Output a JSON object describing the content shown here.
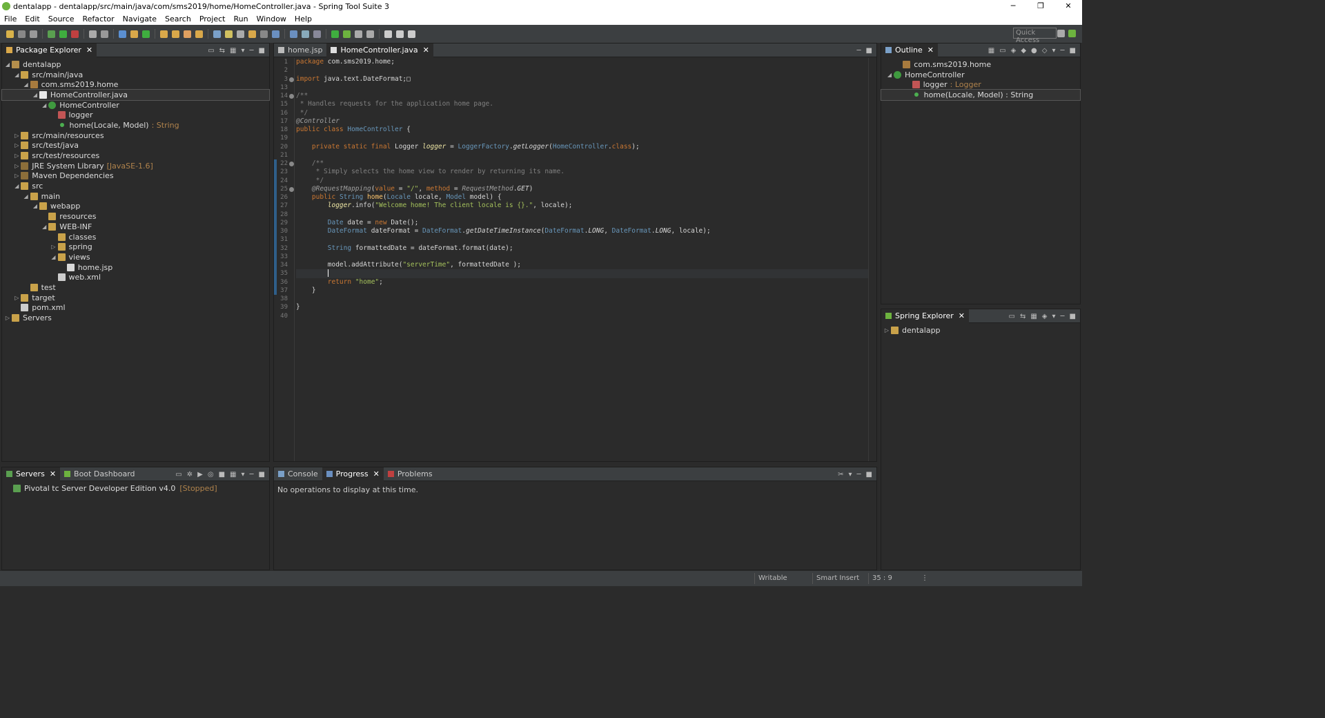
{
  "window": {
    "title": "dentalapp - dentalapp/src/main/java/com/sms2019/home/HomeController.java - Spring Tool Suite 3",
    "minimize": "─",
    "maximize": "❐",
    "close": "✕"
  },
  "menu": [
    "File",
    "Edit",
    "Source",
    "Refactor",
    "Navigate",
    "Search",
    "Project",
    "Run",
    "Window",
    "Help"
  ],
  "toolbar": {
    "quick_access": "Quick Access"
  },
  "package_explorer": {
    "tab": "Package Explorer",
    "tree": [
      {
        "label": "dentalapp",
        "depth": 0,
        "twisty": "◢",
        "icon": "proj"
      },
      {
        "label": "src/main/java",
        "depth": 1,
        "twisty": "◢",
        "icon": "folder"
      },
      {
        "label": "com.sms2019.home",
        "depth": 2,
        "twisty": "◢",
        "icon": "pkg"
      },
      {
        "label": "HomeController.java",
        "depth": 3,
        "twisty": "◢",
        "icon": "java",
        "selected": true
      },
      {
        "label": "HomeController",
        "depth": 4,
        "twisty": "◢",
        "icon": "cls"
      },
      {
        "label": "logger",
        "depth": 5,
        "twisty": "",
        "icon": "field"
      },
      {
        "label": "home(Locale, Model)",
        "suffix": ": String",
        "depth": 5,
        "twisty": "",
        "icon": "method"
      },
      {
        "label": "src/main/resources",
        "depth": 1,
        "twisty": "▷",
        "icon": "folder"
      },
      {
        "label": "src/test/java",
        "depth": 1,
        "twisty": "▷",
        "icon": "folder"
      },
      {
        "label": "src/test/resources",
        "depth": 1,
        "twisty": "▷",
        "icon": "folder"
      },
      {
        "label": "JRE System Library",
        "suffix": "[JavaSE-1.6]",
        "depth": 1,
        "twisty": "▷",
        "icon": "lib"
      },
      {
        "label": "Maven Dependencies",
        "depth": 1,
        "twisty": "▷",
        "icon": "lib"
      },
      {
        "label": "src",
        "depth": 1,
        "twisty": "◢",
        "icon": "folder"
      },
      {
        "label": "main",
        "depth": 2,
        "twisty": "◢",
        "icon": "folder"
      },
      {
        "label": "webapp",
        "depth": 3,
        "twisty": "◢",
        "icon": "folder"
      },
      {
        "label": "resources",
        "depth": 4,
        "twisty": "",
        "icon": "folder"
      },
      {
        "label": "WEB-INF",
        "depth": 4,
        "twisty": "◢",
        "icon": "folder"
      },
      {
        "label": "classes",
        "depth": 5,
        "twisty": "",
        "icon": "folder"
      },
      {
        "label": "spring",
        "depth": 5,
        "twisty": "▷",
        "icon": "folder"
      },
      {
        "label": "views",
        "depth": 5,
        "twisty": "◢",
        "icon": "folder"
      },
      {
        "label": "home.jsp",
        "depth": 6,
        "twisty": "",
        "icon": "jsp"
      },
      {
        "label": "web.xml",
        "depth": 5,
        "twisty": "",
        "icon": "xml"
      },
      {
        "label": "test",
        "depth": 2,
        "twisty": "",
        "icon": "folder"
      },
      {
        "label": "target",
        "depth": 1,
        "twisty": "▷",
        "icon": "folder"
      },
      {
        "label": "pom.xml",
        "depth": 1,
        "twisty": "",
        "icon": "xml"
      },
      {
        "label": "Servers",
        "depth": 0,
        "twisty": "▷",
        "icon": "folder"
      }
    ]
  },
  "editor": {
    "tabs": [
      {
        "label": "home.jsp",
        "active": false
      },
      {
        "label": "HomeController.java",
        "active": true
      }
    ],
    "lines": [
      {
        "n": "1",
        "html": "<span class=\"kw\">package</span> com.sms2019.home;"
      },
      {
        "n": "2",
        "html": ""
      },
      {
        "n": "3",
        "fold": true,
        "html": "<span class=\"kw\">import</span> java.text.DateFormat;&#9633;"
      },
      {
        "n": "13",
        "html": ""
      },
      {
        "n": "14",
        "fold": true,
        "html": "<span class=\"cm\">/**</span>"
      },
      {
        "n": "15",
        "html": "<span class=\"cm\"> * Handles requests for the application home page.</span>"
      },
      {
        "n": "16",
        "html": "<span class=\"cm\"> */</span>"
      },
      {
        "n": "17",
        "html": "<span class=\"an\">@Controller</span>"
      },
      {
        "n": "18",
        "html": "<span class=\"kw\">public class</span> <span class=\"ty\">HomeController</span> {"
      },
      {
        "n": "19",
        "html": ""
      },
      {
        "n": "20",
        "html": "    <span class=\"kw\">private static final</span> Logger <span class=\"fld\">logger</span> = <span class=\"ty\">LoggerFactory</span>.<span class=\"sfld\">getLogger</span>(<span class=\"ty\">HomeController</span>.<span class=\"kw\">class</span>);"
      },
      {
        "n": "21",
        "html": ""
      },
      {
        "n": "22",
        "fold": true,
        "html": "    <span class=\"cm\">/**</span>"
      },
      {
        "n": "23",
        "html": "<span class=\"cm\">     * Simply selects the home view to render by returning its name.</span>"
      },
      {
        "n": "24",
        "html": "<span class=\"cm\">     */</span>"
      },
      {
        "n": "25",
        "fold": true,
        "html": "    <span class=\"an\">@RequestMapping</span>(<span class=\"kw\">value</span> = <span class=\"st\">\"/\"</span>, <span class=\"kw\">method</span> = <span class=\"an\">RequestMethod</span>.<span class=\"sfld\">GET</span>)"
      },
      {
        "n": "26",
        "html": "    <span class=\"kw\">public</span> <span class=\"ty\">String</span> <span class=\"mdecl\">home</span>(<span class=\"ty\">Locale</span> locale, <span class=\"ty\">Model</span> model) {"
      },
      {
        "n": "27",
        "html": "        <span class=\"fld\">logger</span>.info(<span class=\"st\">\"Welcome home! The client locale is {}.\"</span>, locale);"
      },
      {
        "n": "28",
        "html": ""
      },
      {
        "n": "29",
        "html": "        <span class=\"ty\">Date</span> date = <span class=\"kw\">new</span> Date();"
      },
      {
        "n": "30",
        "html": "        <span class=\"ty\">DateFormat</span> dateFormat = <span class=\"ty\">DateFormat</span>.<span class=\"sfld\">getDateTimeInstance</span>(<span class=\"ty\">DateFormat</span>.<span class=\"sfld\">LONG</span>, <span class=\"ty\">DateFormat</span>.<span class=\"sfld\">LONG</span>, locale);"
      },
      {
        "n": "31",
        "html": ""
      },
      {
        "n": "32",
        "html": "        <span class=\"ty\">String</span> formattedDate = dateFormat.format(date);"
      },
      {
        "n": "33",
        "html": ""
      },
      {
        "n": "34",
        "html": "        model.addAttribute(<span class=\"st\">\"serverTime\"</span>, formattedDate );"
      },
      {
        "n": "35",
        "current": true,
        "html": "        <span style=\"border-left:1px solid #fff\"></span>"
      },
      {
        "n": "36",
        "html": "        <span class=\"kw\">return</span> <span class=\"st\">\"home\"</span>;"
      },
      {
        "n": "37",
        "html": "    }"
      },
      {
        "n": "38",
        "html": ""
      },
      {
        "n": "39",
        "html": "}"
      },
      {
        "n": "40",
        "html": ""
      }
    ]
  },
  "outline": {
    "tab": "Outline",
    "tree": [
      {
        "label": "com.sms2019.home",
        "depth": 1,
        "twisty": "",
        "icon": "pkg"
      },
      {
        "label": "HomeController",
        "depth": 0,
        "twisty": "◢",
        "icon": "cls"
      },
      {
        "label": "logger",
        "suffix": ": Logger",
        "depth": 2,
        "twisty": "",
        "icon": "field"
      },
      {
        "label": "home(Locale, Model) : String",
        "depth": 2,
        "twisty": "",
        "icon": "method",
        "selected": true
      }
    ]
  },
  "spring_explorer": {
    "tab": "Spring Explorer",
    "tree": [
      {
        "label": "dentalapp",
        "depth": 0,
        "twisty": "▷",
        "icon": "folder"
      }
    ]
  },
  "servers_panel": {
    "tabs": [
      {
        "label": "Servers",
        "active": true
      },
      {
        "label": "Boot Dashboard",
        "active": false
      }
    ],
    "server_name": "Pivotal tc Server Developer Edition v4.0",
    "server_state": "[Stopped]"
  },
  "bottom_panel": {
    "tabs": [
      {
        "label": "Console",
        "active": false
      },
      {
        "label": "Progress",
        "active": true
      },
      {
        "label": "Problems",
        "active": false
      }
    ],
    "message": "No operations to display at this time."
  },
  "statusbar": {
    "writable": "Writable",
    "insert_mode": "Smart Insert",
    "position": "35 : 9",
    "more": "⋮"
  }
}
